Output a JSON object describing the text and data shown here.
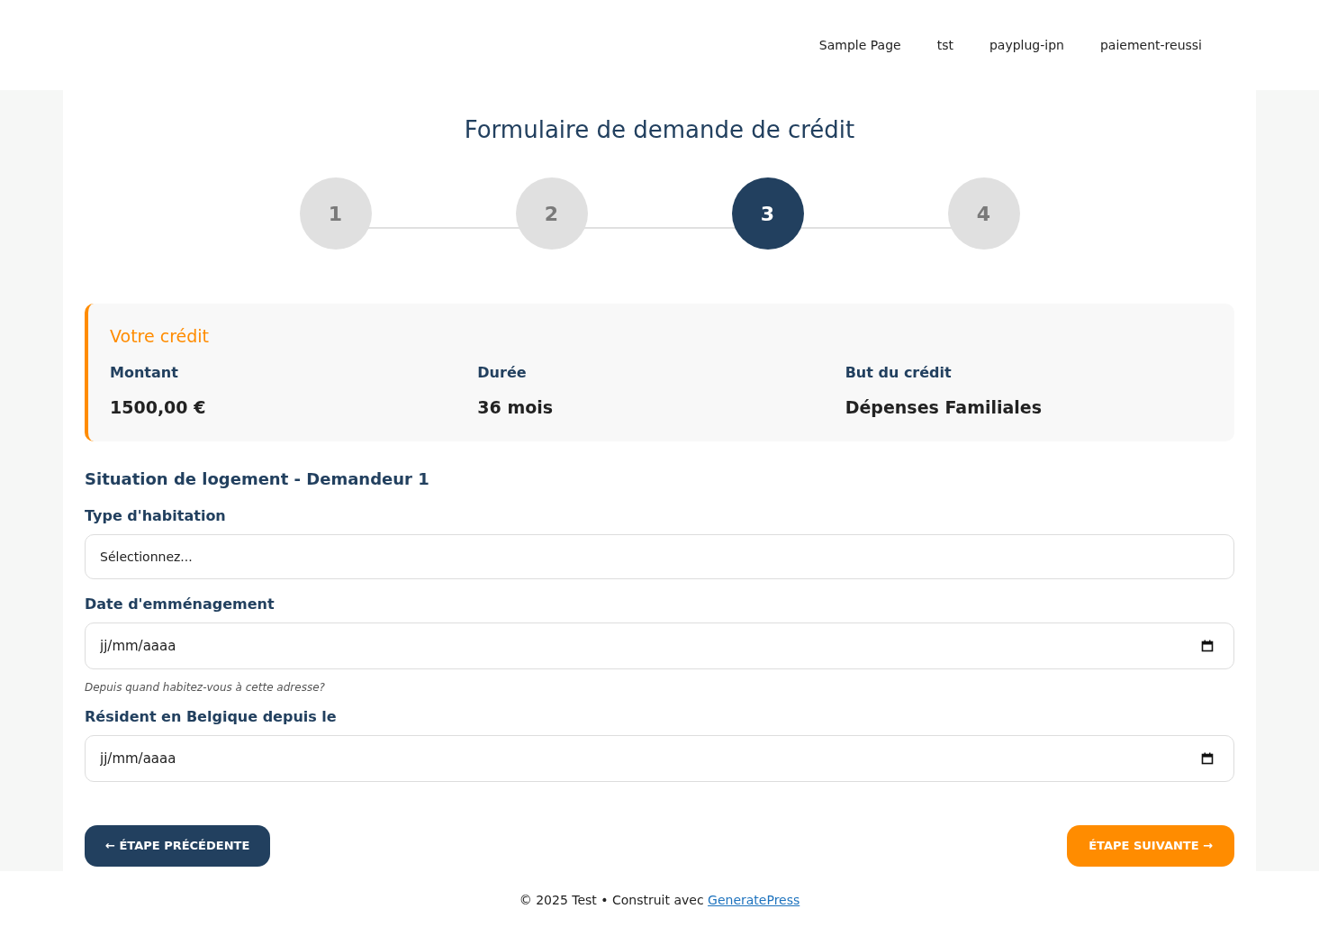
{
  "nav": {
    "items": [
      {
        "label": "Sample Page"
      },
      {
        "label": "tst"
      },
      {
        "label": "payplug-ipn"
      },
      {
        "label": "paiement-reussi"
      }
    ]
  },
  "title": "Formulaire de demande de crédit",
  "steps": [
    {
      "label": "1",
      "selected": false
    },
    {
      "label": "2",
      "selected": false
    },
    {
      "label": "3",
      "selected": true
    },
    {
      "label": "4",
      "selected": false
    }
  ],
  "summary": {
    "title": "Votre crédit",
    "items": [
      {
        "label": "Montant",
        "value": "1500,00 €"
      },
      {
        "label": "Durée",
        "value": "36 mois"
      },
      {
        "label": "But du crédit",
        "value": "Dépenses Familiales"
      }
    ]
  },
  "section_title": "Situation de logement - Demandeur 1",
  "fields": [
    {
      "kind": "select",
      "label": "Type d'habitation",
      "value": "Sélectionnez..."
    },
    {
      "kind": "date",
      "label": "Date d'emménagement",
      "placeholder": "jj/mm/aaaa",
      "help": "Depuis quand habitez-vous à cette adresse?"
    },
    {
      "kind": "date",
      "label": "Résident en Belgique depuis le",
      "placeholder": "jj/mm/aaaa"
    }
  ],
  "buttons": {
    "previous": "← ÉTAPE PRÉCÉDENTE",
    "next": "ÉTAPE SUIVANTE →"
  },
  "footer": {
    "text": "© 2025 Test • Construit avec ",
    "link": "GeneratePress"
  }
}
